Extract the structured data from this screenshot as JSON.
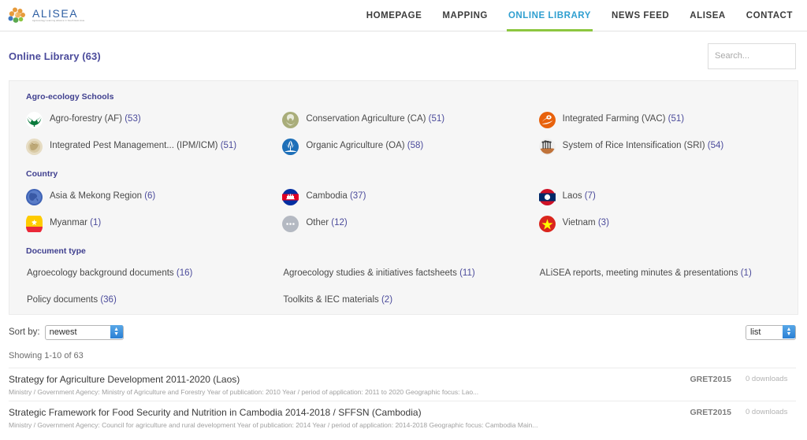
{
  "site": {
    "logo_word": "ALISEA",
    "logo_tagline": "Agroecology Learning alliance in South East Asia"
  },
  "nav": {
    "items": [
      {
        "label": "HOMEPAGE",
        "active": false
      },
      {
        "label": "MAPPING",
        "active": false
      },
      {
        "label": "ONLINE LIBRARY",
        "active": true
      },
      {
        "label": "NEWS FEED",
        "active": false
      },
      {
        "label": "ALISEA",
        "active": false
      },
      {
        "label": "CONTACT",
        "active": false
      }
    ],
    "active_underline_color": "#8cc63f",
    "active_color": "#2f9fd0"
  },
  "page": {
    "title": "Online Library (63)",
    "title_color": "#4b4b9b"
  },
  "search": {
    "placeholder": "Search...",
    "value": ""
  },
  "facets": {
    "groups": [
      {
        "title": "Agro-ecology Schools",
        "rows": [
          [
            {
              "icon": "agroforestry-icon",
              "label": "Agro-forestry (AF)",
              "count": "(53)"
            },
            {
              "icon": "conservation-agriculture-icon",
              "label": "Conservation Agriculture (CA)",
              "count": "(51)"
            },
            {
              "icon": "integrated-farming-icon",
              "label": "Integrated Farming (VAC)",
              "count": "(51)"
            }
          ],
          [
            {
              "icon": "integrated-pest-management-icon",
              "label": "Integrated Pest Management... (IPM/ICM)",
              "count": "(51)"
            },
            {
              "icon": "organic-agriculture-icon",
              "label": "Organic Agriculture (OA)",
              "count": "(58)"
            },
            {
              "icon": "system-rice-intensification-icon",
              "label": "System of Rice Intensification (SRI)",
              "count": "(54)"
            }
          ]
        ]
      },
      {
        "title": "Country",
        "rows": [
          [
            {
              "icon": "asia-mekong-icon",
              "label": "Asia & Mekong Region",
              "count": "(6)"
            },
            {
              "icon": "cambodia-flag-icon",
              "label": "Cambodia",
              "count": "(37)"
            },
            {
              "icon": "laos-flag-icon",
              "label": "Laos",
              "count": "(7)"
            }
          ],
          [
            {
              "icon": "myanmar-flag-icon",
              "label": "Myanmar",
              "count": "(1)"
            },
            {
              "icon": "other-icon",
              "label": "Other",
              "count": "(12)"
            },
            {
              "icon": "vietnam-flag-icon",
              "label": "Vietnam",
              "count": "(3)"
            }
          ]
        ]
      },
      {
        "title": "Document type",
        "rows": [
          [
            {
              "icon": "",
              "label": "Agroecology background documents",
              "count": "(16)"
            },
            {
              "icon": "",
              "label": "Agroecology studies & initiatives factsheets",
              "count": "(11)"
            },
            {
              "icon": "",
              "label": "ALiSEA reports, meeting minutes & presentations",
              "count": "(1)"
            }
          ],
          [
            {
              "icon": "",
              "label": "Policy documents",
              "count": "(36)"
            },
            {
              "icon": "",
              "label": "Toolkits & IEC materials",
              "count": "(2)"
            },
            {
              "icon": "",
              "label": "",
              "count": ""
            }
          ]
        ]
      }
    ]
  },
  "sortbar": {
    "sort_label": "Sort by:",
    "sort_value": "newest",
    "sort_options": [
      "newest"
    ],
    "view_value": "list",
    "view_options": [
      "list"
    ]
  },
  "results": {
    "showing": "Showing 1-10 of 63",
    "items": [
      {
        "title": "Strategy for Agriculture Development 2011-2020 (Laos)",
        "meta": "Ministry / Government Agency: Ministry of Agriculture and Forestry Year of publication: 2010 Year / period of application: 2011 to 2020 Geographic focus: Lao...",
        "source": "GRET2015",
        "downloads": "0 downloads"
      },
      {
        "title": "Strategic Framework for Food Security and Nutrition in Cambodia 2014-2018 / SFFSN (Cambodia)",
        "meta": "Ministry / Government Agency: Council for agriculture and rural development Year of publication: 2014 Year / period of application: 2014-2018 Geographic focus: Cambodia Main...",
        "source": "GRET2015",
        "downloads": "0 downloads"
      }
    ]
  }
}
